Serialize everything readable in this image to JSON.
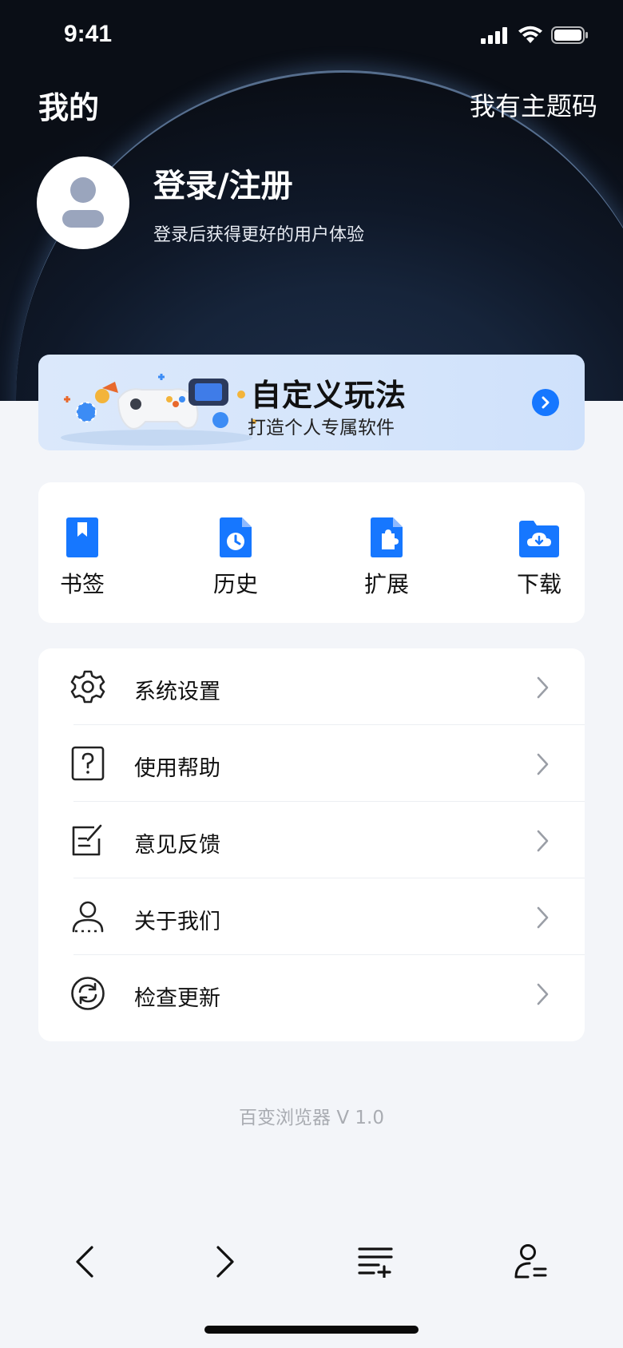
{
  "status_bar": {
    "time": "9:41",
    "signal_icon": "signal-icon",
    "wifi_icon": "wifi-icon",
    "battery_icon": "battery-icon"
  },
  "header": {
    "title": "我的",
    "theme_code": "我有主题码"
  },
  "profile": {
    "title": "登录/注册",
    "subtitle": "登录后获得更好的用户体验",
    "avatar_icon": "person-icon"
  },
  "banner": {
    "title": "自定义玩法",
    "subtitle": "打造个人专属软件",
    "arrow_icon": "chevron-right-icon"
  },
  "quick_actions": [
    {
      "label": "书签",
      "icon": "bookmark-icon"
    },
    {
      "label": "历史",
      "icon": "history-icon"
    },
    {
      "label": "扩展",
      "icon": "extension-icon"
    },
    {
      "label": "下载",
      "icon": "download-icon"
    }
  ],
  "menu": [
    {
      "label": "系统设置",
      "icon": "gear-icon"
    },
    {
      "label": "使用帮助",
      "icon": "help-icon"
    },
    {
      "label": "意见反馈",
      "icon": "feedback-icon"
    },
    {
      "label": "关于我们",
      "icon": "user-icon"
    },
    {
      "label": "检查更新",
      "icon": "refresh-icon"
    }
  ],
  "version": "百变浏览器 V 1.0",
  "bottom_nav": [
    {
      "icon": "back-icon"
    },
    {
      "icon": "forward-icon"
    },
    {
      "icon": "tabs-menu-icon"
    },
    {
      "icon": "profile-icon"
    }
  ],
  "colors": {
    "accent": "#1677ff",
    "background": "#f3f5f9",
    "hero": "#0f1828"
  }
}
